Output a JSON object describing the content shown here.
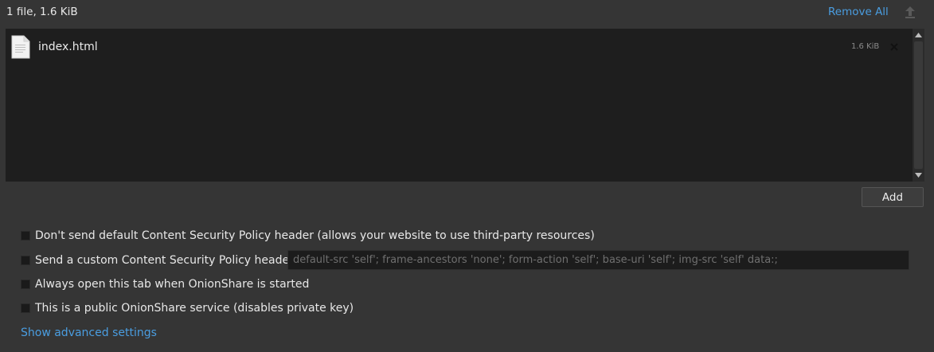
{
  "header": {
    "summary": "1 file, 1.6 KiB",
    "remove_all_label": "Remove All",
    "upload_icon": "upload-arrow-icon"
  },
  "files": [
    {
      "name": "index.html",
      "size": "1.6 KiB",
      "icon": "document-icon"
    }
  ],
  "add_button_label": "Add",
  "options": {
    "no_csp_label": "Don't send default Content Security Policy header (allows your website to use third-party resources)",
    "no_csp_checked": false,
    "custom_csp_label": "Send a custom Content Security Policy header",
    "custom_csp_checked": false,
    "custom_csp_placeholder": "default-src 'self'; frame-ancestors 'none'; form-action 'self'; base-uri 'self'; img-src 'self' data:;",
    "always_open_label": "Always open this tab when OnionShare is started",
    "always_open_checked": false,
    "public_label": "This is a public OnionShare service (disables private key)",
    "public_checked": false
  },
  "advanced_link_label": "Show advanced settings",
  "colors": {
    "background": "#353535",
    "list_background": "#1e1e1e",
    "link": "#4a9de0"
  }
}
